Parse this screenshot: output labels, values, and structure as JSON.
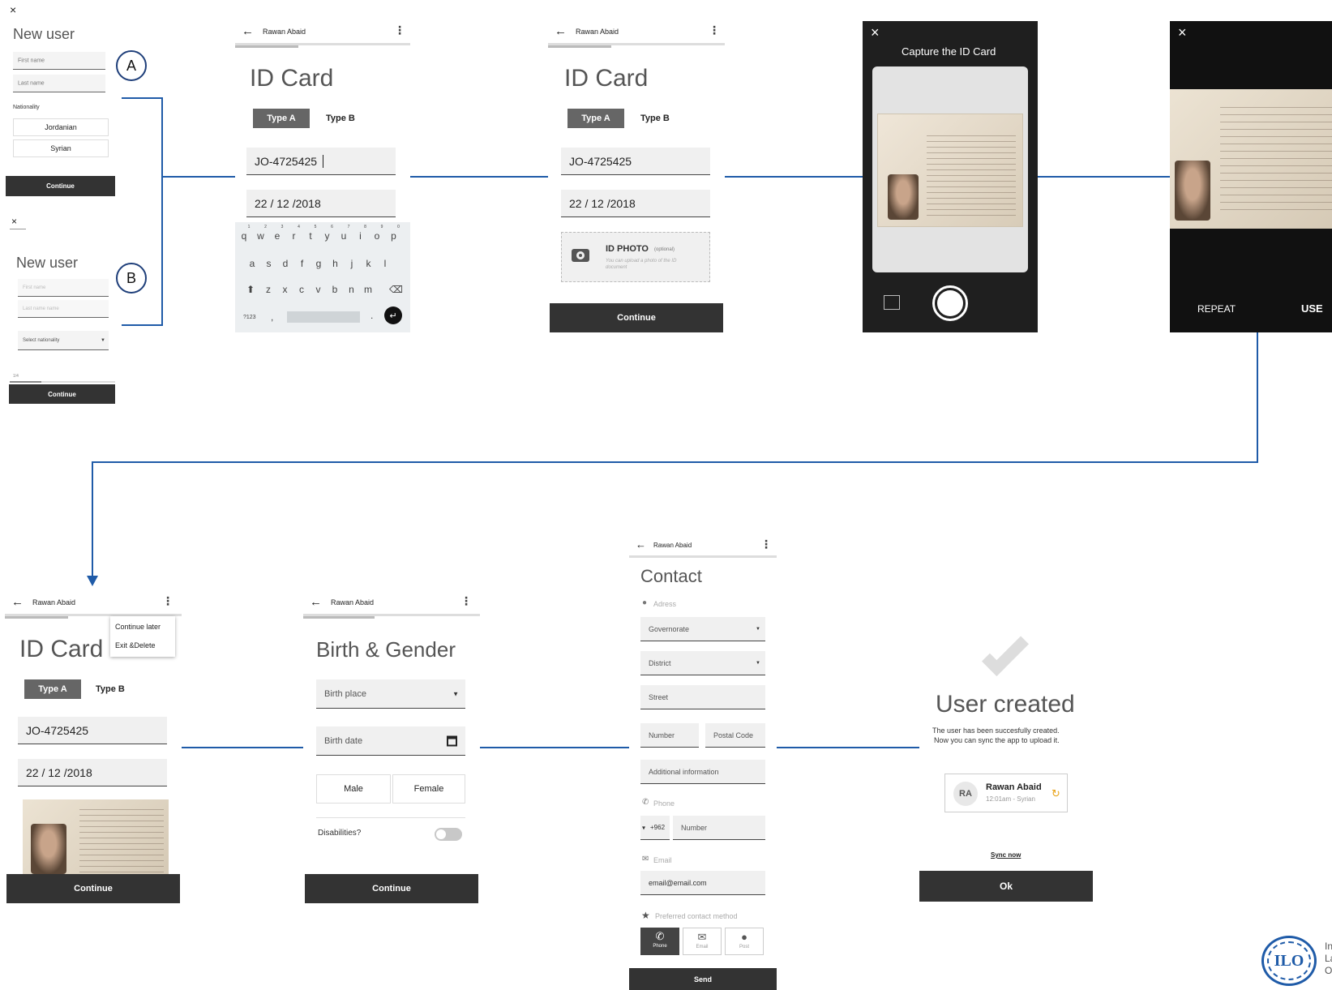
{
  "screen_a": {
    "close": "×",
    "title": "New user",
    "first_name": "First name",
    "last_name": "Last name",
    "nationality_label": "Nationality",
    "nationality_options": [
      "Jordanian",
      "Syrian"
    ],
    "continue": "Continue",
    "marker": "A"
  },
  "screen_b": {
    "close": "×",
    "title": "New user",
    "first_name": "First name",
    "last_name": "Last name name",
    "select": "Select nationality",
    "step": "1/4",
    "continue": "Continue",
    "marker": "B"
  },
  "user_name": "Rawan Abaid",
  "id_card": {
    "title": "ID Card",
    "type_a": "Type A",
    "type_b": "Type B",
    "id_number": "JO-4725425",
    "date": "22 / 12 /2018",
    "photo_title": "ID PHOTO",
    "photo_optional": "(optional)",
    "photo_hint": "You can upload a photo of the ID document",
    "continue": "Continue"
  },
  "keyboard": {
    "row1": [
      "q",
      "w",
      "e",
      "r",
      "t",
      "y",
      "u",
      "i",
      "o",
      "p"
    ],
    "row1_nums": [
      "1",
      "2",
      "3",
      "4",
      "5",
      "6",
      "7",
      "8",
      "9",
      "0"
    ],
    "row2": [
      "a",
      "s",
      "d",
      "f",
      "g",
      "h",
      "j",
      "k",
      "l"
    ],
    "row3": [
      "z",
      "x",
      "c",
      "v",
      "b",
      "n",
      "m"
    ],
    "sym": "?123",
    "comma": ",",
    "dot": "."
  },
  "camera": {
    "close": "×",
    "title": "Capture the ID Card"
  },
  "preview": {
    "close": "×",
    "repeat": "REPEAT",
    "use": "USE"
  },
  "menu": {
    "continue_later": "Continue later",
    "exit_delete": "Exit &Delete"
  },
  "birth": {
    "title": "Birth & Gender",
    "birth_place": "Birth place",
    "birth_date": "Birth date",
    "male": "Male",
    "female": "Female",
    "disabilities": "Disabilities?",
    "continue": "Continue"
  },
  "contact": {
    "title": "Contact",
    "address": "Adress",
    "governorate": "Governorate",
    "district": "District",
    "street": "Street",
    "number": "Number",
    "postal": "Postal Code",
    "additional": "Additional information",
    "phone": "Phone",
    "code": "+962",
    "phone_number": "Number",
    "email": "Email",
    "email_value": "email@email.com",
    "preferred": "Preferred contact method",
    "methods": [
      "Phone",
      "Email",
      "Post"
    ],
    "send": "Send"
  },
  "done": {
    "title": "User created",
    "message_1": "The user has been succesfully created.",
    "message_2": "Now you can sync the app to upload it.",
    "initials": "RA",
    "user_meta": "12:01am - Syrian",
    "sync": "Sync now",
    "ok": "Ok"
  },
  "logo": {
    "lettering": "ILO",
    "side_text": [
      "In",
      "La",
      "O"
    ]
  },
  "colors": {
    "connector": "#1f5ba8",
    "dark": "#333333",
    "camera_bg": "#1f1f1f",
    "sync_icon": "#e8a317"
  }
}
